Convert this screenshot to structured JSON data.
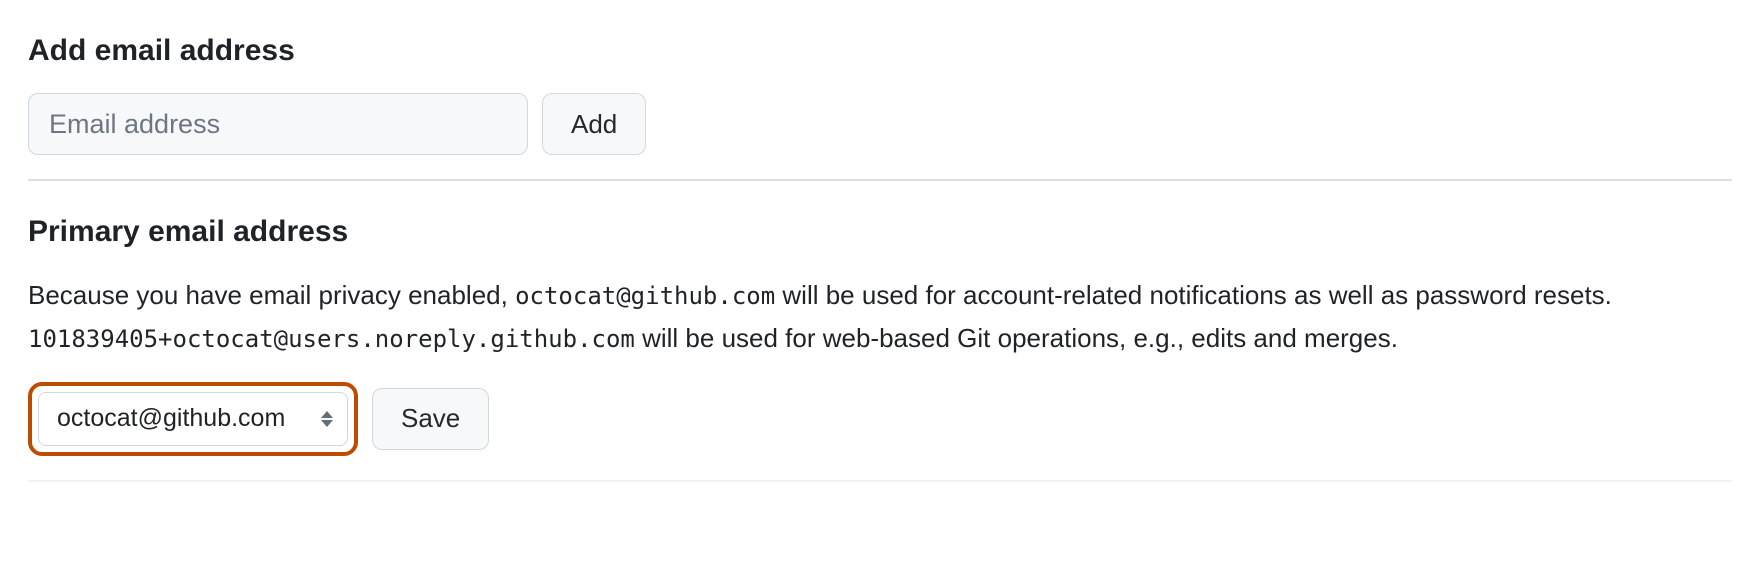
{
  "add_section": {
    "title": "Add email address",
    "input_placeholder": "Email address",
    "button_label": "Add"
  },
  "primary_section": {
    "title": "Primary email address",
    "desc_part1": "Because you have email privacy enabled, ",
    "email_primary": "octocat@github.com",
    "desc_part2": " will be used for account-related notifications as well as password resets. ",
    "email_noreply": "101839405+octocat@users.noreply.github.com",
    "desc_part3": " will be used for web-based Git operations, e.g., edits and merges.",
    "select_value": "octocat@github.com",
    "save_label": "Save"
  }
}
